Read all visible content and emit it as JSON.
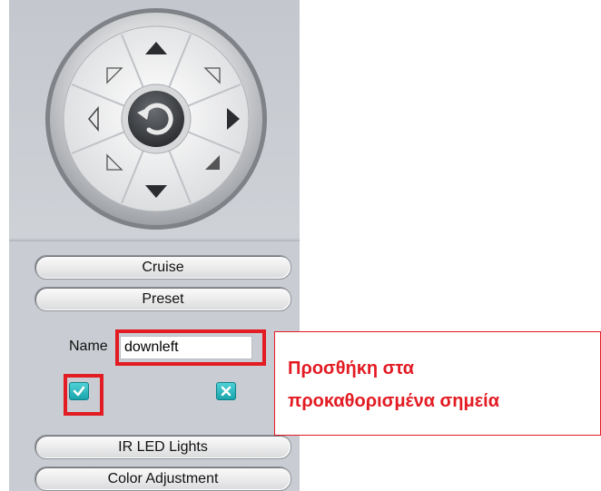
{
  "ptz": {
    "up_icon": "arrow-up-icon",
    "down_icon": "arrow-down-icon",
    "left_icon": "arrow-left-icon",
    "right_icon": "arrow-right-icon",
    "home_icon": "rotate-reset-icon"
  },
  "menu": {
    "cruise_label": "Cruise",
    "preset_label": "Preset",
    "ir_label": "IR LED Lights",
    "color_label": "Color Adjustment"
  },
  "preset_form": {
    "name_label": "Name",
    "name_value": "downleft",
    "confirm_icon": "checkmark-icon",
    "cancel_icon": "close-icon"
  },
  "annotation": {
    "line1": "Προσθήκη στα",
    "line2": "προκαθορισμένα σημεία"
  },
  "colors": {
    "highlight": "#e31b23",
    "panel_bg": "#c9cdd3",
    "icon_accent": "#1aa4ac"
  }
}
